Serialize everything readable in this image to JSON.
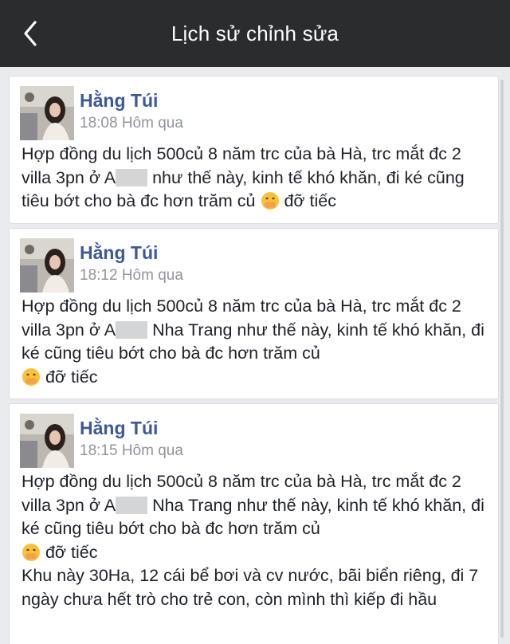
{
  "header": {
    "title": "Lịch sử chỉnh sửa",
    "back_icon": "chevron-left-icon"
  },
  "revisions": [
    {
      "author": "Hằng Túi",
      "time": "18:08 Hôm qua",
      "text_a": "Hợp đồng du lịch 500củ 8 năm trc của bà Hà, trc mắt đc 2 villa 3pn ở A",
      "text_b": " như thế này, kinh tế khó khăn, đi ké cũng tiêu bớt cho bà đc hơn trăm củ ",
      "text_c": " đỡ tiếc"
    },
    {
      "author": "Hằng Túi",
      "time": "18:12 Hôm qua",
      "text_a": "Hợp đồng du lịch 500củ 8 năm trc của bà Hà, trc mắt đc 2 villa 3pn ở A",
      "text_b": " Nha Trang như thế này, kinh tế khó khăn, đi ké cũng tiêu bớt cho bà đc hơn trăm củ ",
      "text_c": " đỡ tiếc"
    },
    {
      "author": "Hằng Túi",
      "time": "18:15 Hôm qua",
      "text_a": "Hợp đồng du lịch 500củ 8 năm trc của bà Hà, trc mắt đc 2 villa 3pn ở A",
      "text_b": " Nha Trang như thế này, kinh tế khó khăn, đi ké cũng tiêu bớt cho bà đc hơn trăm củ ",
      "text_c": " đỡ tiếc",
      "text_d": "Khu này 30Ha, 12 cái bể bơi và cv nước, bãi biển riêng, đi 7 ngày chưa hết trò cho trẻ con, còn mình thì kiếp đi hầu"
    }
  ],
  "colors": {
    "header_bg": "#2b2c2e",
    "author": "#3b5998",
    "time": "#90949c",
    "page_bg": "#e9ebee"
  }
}
